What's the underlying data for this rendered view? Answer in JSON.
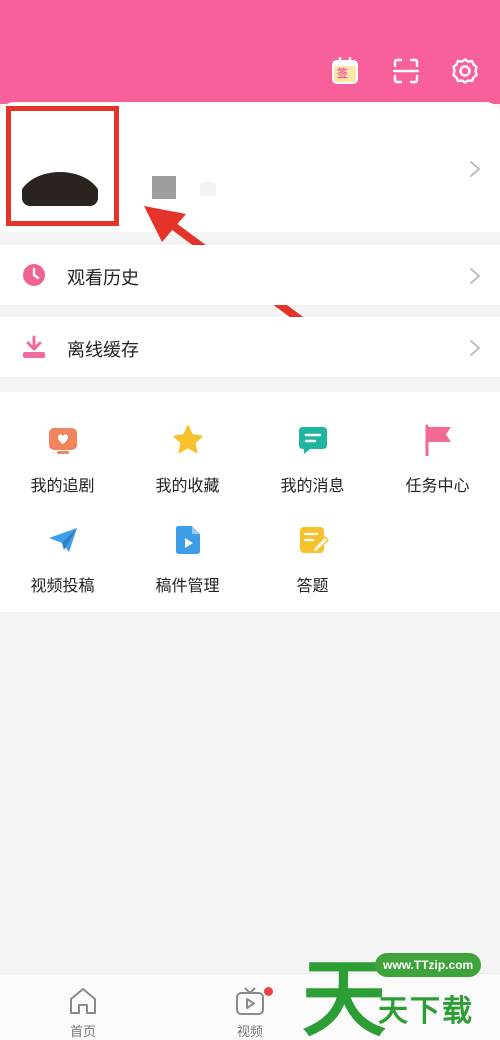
{
  "header": {
    "bg_color": "#f7609a",
    "icons": [
      {
        "name": "sign-in-calendar-icon",
        "glyph": "签"
      },
      {
        "name": "scan-icon"
      },
      {
        "name": "settings-gear-icon"
      }
    ]
  },
  "profile": {
    "avatar": "avatar",
    "annotation": "red-highlight-box-with-arrow"
  },
  "menu": [
    {
      "label": "观看历史",
      "icon": "clock-icon",
      "color": "#f06292"
    },
    {
      "label": "离线缓存",
      "icon": "download-icon",
      "color": "#ef6aa2"
    }
  ],
  "grid": [
    {
      "label": "我的追剧",
      "icon": "tv-heart-icon",
      "color": "#f0845c"
    },
    {
      "label": "我的收藏",
      "icon": "star-icon",
      "color": "#f6c12a"
    },
    {
      "label": "我的消息",
      "icon": "message-icon",
      "color": "#1fb5a0"
    },
    {
      "label": "任务中心",
      "icon": "flag-icon",
      "color": "#f06a94"
    },
    {
      "label": "视频投稿",
      "icon": "paper-plane-icon",
      "color": "#3f9de8"
    },
    {
      "label": "稿件管理",
      "icon": "video-file-icon",
      "color": "#3f9de8"
    },
    {
      "label": "答题",
      "icon": "quiz-pencil-icon",
      "color": "#f6c12a"
    }
  ],
  "tabbar": [
    {
      "label": "首页",
      "icon": "home-icon"
    },
    {
      "label": "视频",
      "icon": "video-tv-icon",
      "badge": true
    }
  ],
  "watermark": {
    "url": "www.TTzip.com",
    "text": "天下载",
    "big_char": "天",
    "color": "#2d9e35"
  }
}
